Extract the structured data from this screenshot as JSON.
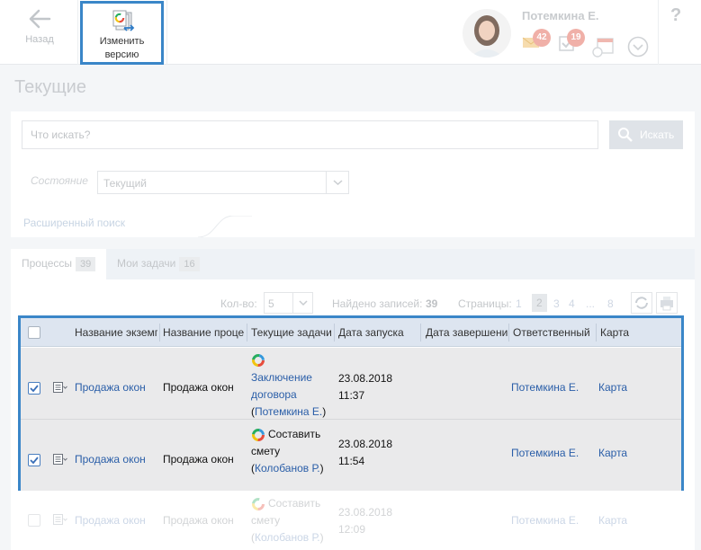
{
  "toolbar": {
    "back_label": "Назад",
    "change_version_label_line1": "Изменить",
    "change_version_label_line2": "версию"
  },
  "user": {
    "name": "Потемкина Е.",
    "mail_count": "42",
    "tasks_count": "19"
  },
  "help": "?",
  "page": {
    "title": "Текущие"
  },
  "search": {
    "placeholder": "Что искать?",
    "button_label": "Искать",
    "state_label": "Состояние",
    "state_value": "Текущий",
    "advanced_label": "Расширенный поиск"
  },
  "tabs": [
    {
      "label": "Процессы",
      "count": "39"
    },
    {
      "label": "Мои задачи",
      "count": "16"
    }
  ],
  "pager": {
    "per_page_label": "Кол-во:",
    "per_page_value": "5",
    "found_label": "Найдено записей:",
    "found_value": "39",
    "pages_label": "Страницы:",
    "pages": [
      "1",
      "2",
      "3",
      "4",
      "...",
      "8"
    ],
    "current_page": "2"
  },
  "table": {
    "columns": [
      "Название экземп",
      "Название проце",
      "Текущие задачи",
      "Дата запуска",
      "Дата завершени",
      "Ответственный",
      "Карта"
    ],
    "rows": [
      {
        "instance": "Продажа окон",
        "process": "Продажа окон",
        "task_line1": "Заключение",
        "task_line2": "договора",
        "task_open": "(",
        "task_user": "Потемкина Е.",
        "task_close": ")",
        "start_date": "23.08.2018",
        "start_time": "11:37",
        "responsible": "Потемкина Е.",
        "map": "Карта"
      },
      {
        "instance": "Продажа окон",
        "process": "Продажа окон",
        "task_line1": "Составить",
        "task_line2": "смету",
        "task_open": "(",
        "task_user": "Колобанов Р.",
        "task_close": ")",
        "start_date": "23.08.2018",
        "start_time": "11:54",
        "responsible": "Потемкина Е.",
        "map": "Карта"
      },
      {
        "instance": "Продажа окон",
        "process": "Продажа окон",
        "task_line1": "Составить",
        "task_line2": "смету",
        "task_open": "(",
        "task_user": "Колобанов Р.",
        "task_close": ")",
        "start_date": "23.08.2018",
        "start_time": "12:09",
        "responsible": "Потемкина Е.",
        "map": "Карта"
      }
    ]
  },
  "colors": {
    "accent_border": "#3a86c8",
    "link": "#2a5ea8",
    "header_bg": "#dde5f0"
  }
}
